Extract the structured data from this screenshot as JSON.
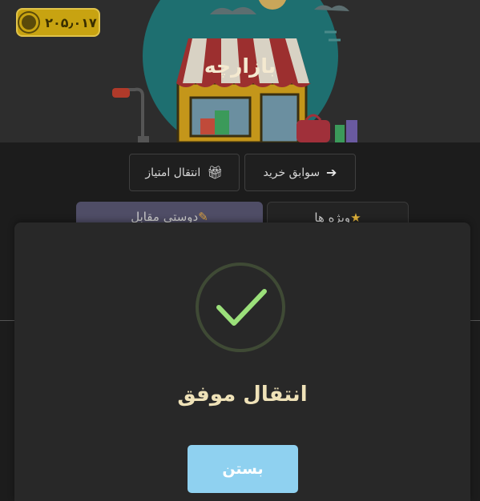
{
  "balance": {
    "amount": "۲۰۵٫۰۱۷",
    "icon": "coin-icon"
  },
  "hero": {
    "title": "بازارچه"
  },
  "actions": {
    "history_label": "سوابق خرید",
    "history_icon": "arrow-right-icon",
    "transfer_label": "انتقال امتیاز",
    "transfer_icon": "gift-icon"
  },
  "tabs": [
    {
      "label": "ویژه ها",
      "icon": "star-icon"
    },
    {
      "label": "دوستی مقابل",
      "icon": "pencil-icon"
    }
  ],
  "modal": {
    "title": "انتقال موفق",
    "close_label": "بستن",
    "icon": "checkmark-icon",
    "accent_color": "#9be07a",
    "button_color": "#8fd1f0"
  }
}
